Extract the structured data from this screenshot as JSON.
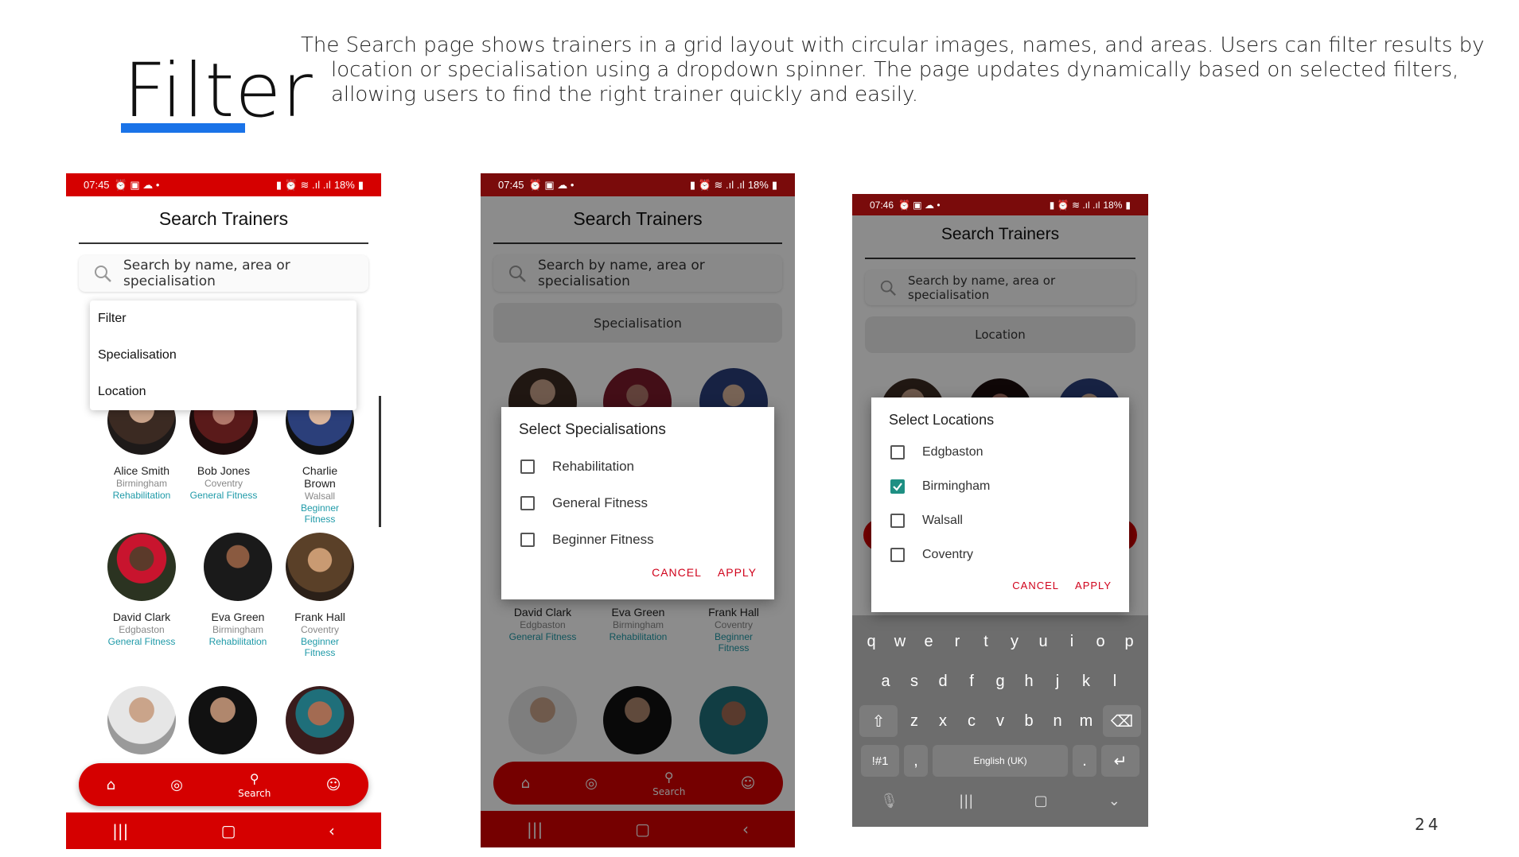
{
  "slide": {
    "title": "Filter",
    "description": "The Search page shows trainers in a grid layout with circular images, names, and areas. Users can filter results by location or specialisation using a dropdown spinner. The page updates dynamically based on selected filters, allowing users to find the right trainer quickly and easily.",
    "page_number": "24",
    "accent_color": "#1a73e8"
  },
  "app": {
    "brand_color": "#d50000",
    "dark_status_color": "#7a0b0b",
    "title": "Search Trainers",
    "search_placeholder": "Search by name, area or\nspecialisation",
    "nav": {
      "search_label": "Search"
    }
  },
  "phone1": {
    "status_time": "07:45",
    "status_battery": "18%",
    "dropdown": [
      "Filter",
      "Specialisation",
      "Location"
    ],
    "trainers_row1": [
      {
        "name": "Alice Smith",
        "area": "Birmingham",
        "spec": "Rehabilitation"
      },
      {
        "name": "Bob Jones",
        "area": "Coventry",
        "spec": "General Fitness"
      },
      {
        "name": "Charlie\nBrown",
        "area": "Walsall",
        "spec": "Beginner\nFitness"
      }
    ],
    "trainers_row2": [
      {
        "name": "David Clark",
        "area": "Edgbaston",
        "spec": "General Fitness"
      },
      {
        "name": "Eva Green",
        "area": "Birmingham",
        "spec": "Rehabilitation"
      },
      {
        "name": "Frank Hall",
        "area": "Coventry",
        "spec": "Beginner\nFitness"
      }
    ]
  },
  "phone2": {
    "status_time": "07:45",
    "status_battery": "18%",
    "filter_value": "Specialisation",
    "dialog": {
      "title": "Select Specialisations",
      "options": [
        {
          "label": "Rehabilitation",
          "checked": false
        },
        {
          "label": "General Fitness",
          "checked": false
        },
        {
          "label": "Beginner Fitness",
          "checked": false
        }
      ],
      "cancel": "CANCEL",
      "apply": "APPLY"
    },
    "trainers_row2": [
      {
        "name": "David Clark",
        "area": "Edgbaston",
        "spec": "General Fitness"
      },
      {
        "name": "Eva Green",
        "area": "Birmingham",
        "spec": "Rehabilitation"
      },
      {
        "name": "Frank Hall",
        "area": "Coventry",
        "spec": "Beginner\nFitness"
      }
    ]
  },
  "phone3": {
    "status_time": "07:46",
    "status_battery": "18%",
    "filter_value": "Location",
    "dialog": {
      "title": "Select Locations",
      "options": [
        {
          "label": "Edgbaston",
          "checked": false
        },
        {
          "label": "Birmingham",
          "checked": true
        },
        {
          "label": "Walsall",
          "checked": false
        },
        {
          "label": "Coventry",
          "checked": false
        }
      ],
      "cancel": "CANCEL",
      "apply": "APPLY"
    },
    "keyboard": {
      "row1": [
        "q",
        "w",
        "e",
        "r",
        "t",
        "y",
        "u",
        "i",
        "o",
        "p"
      ],
      "row2": [
        "a",
        "s",
        "d",
        "f",
        "g",
        "h",
        "j",
        "k",
        "l"
      ],
      "row3": [
        "z",
        "x",
        "c",
        "v",
        "b",
        "n",
        "m"
      ],
      "symbols": "!#1",
      "comma": ",",
      "space": "English (UK)",
      "period": "."
    }
  }
}
